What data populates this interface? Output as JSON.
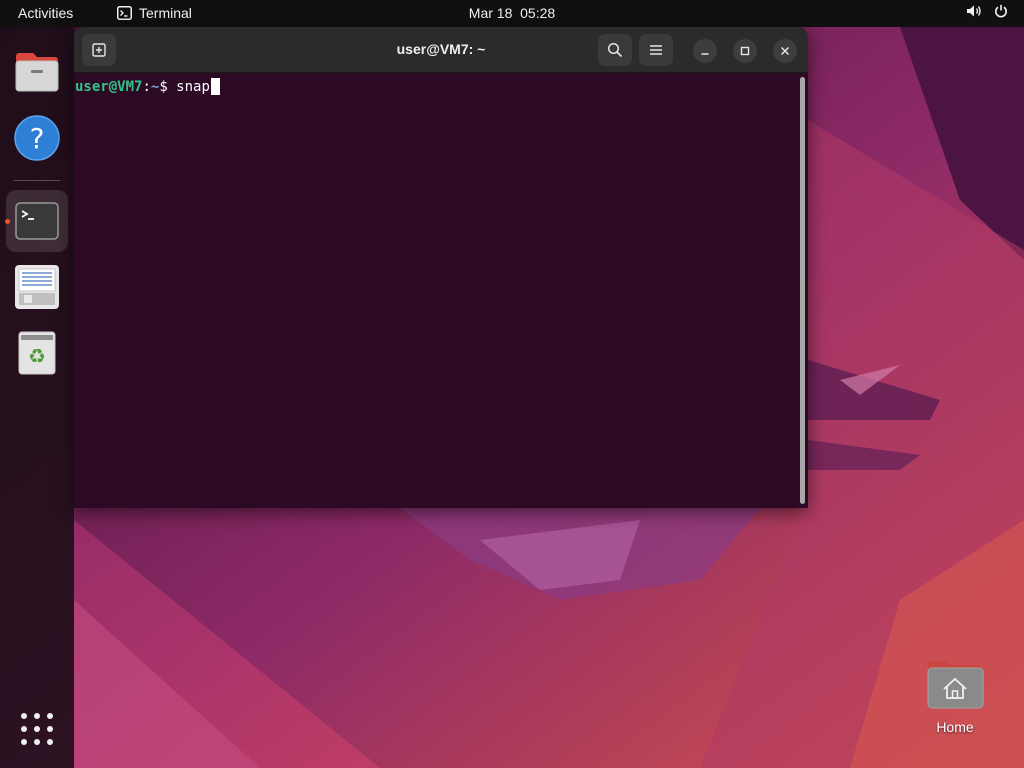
{
  "topbar": {
    "activities": "Activities",
    "app_name": "Terminal",
    "clock": "Mar 18  05:28"
  },
  "dock": {
    "items": [
      {
        "name": "Files",
        "icon": "files-icon"
      },
      {
        "name": "Help",
        "icon": "help-icon"
      },
      {
        "name": "Terminal",
        "icon": "terminal-icon",
        "running": true
      },
      {
        "name": "Text Editor",
        "icon": "text-editor-icon"
      },
      {
        "name": "Trash",
        "icon": "trash-icon"
      }
    ],
    "apps_grid_icon": "show-apps-icon"
  },
  "terminal": {
    "title": "user@VM7: ~",
    "prompt_user": "user@VM7",
    "prompt_sep": ":",
    "prompt_path": "~",
    "prompt_symbol": "$ ",
    "command": "snap"
  },
  "desktop": {
    "home_label": "Home"
  },
  "colors": {
    "topbar": "#101010",
    "terminal_bg": "#2c0a24",
    "prompt_user": "#33c48a",
    "prompt_path": "#7aa0e0",
    "accent": "#e95420"
  }
}
